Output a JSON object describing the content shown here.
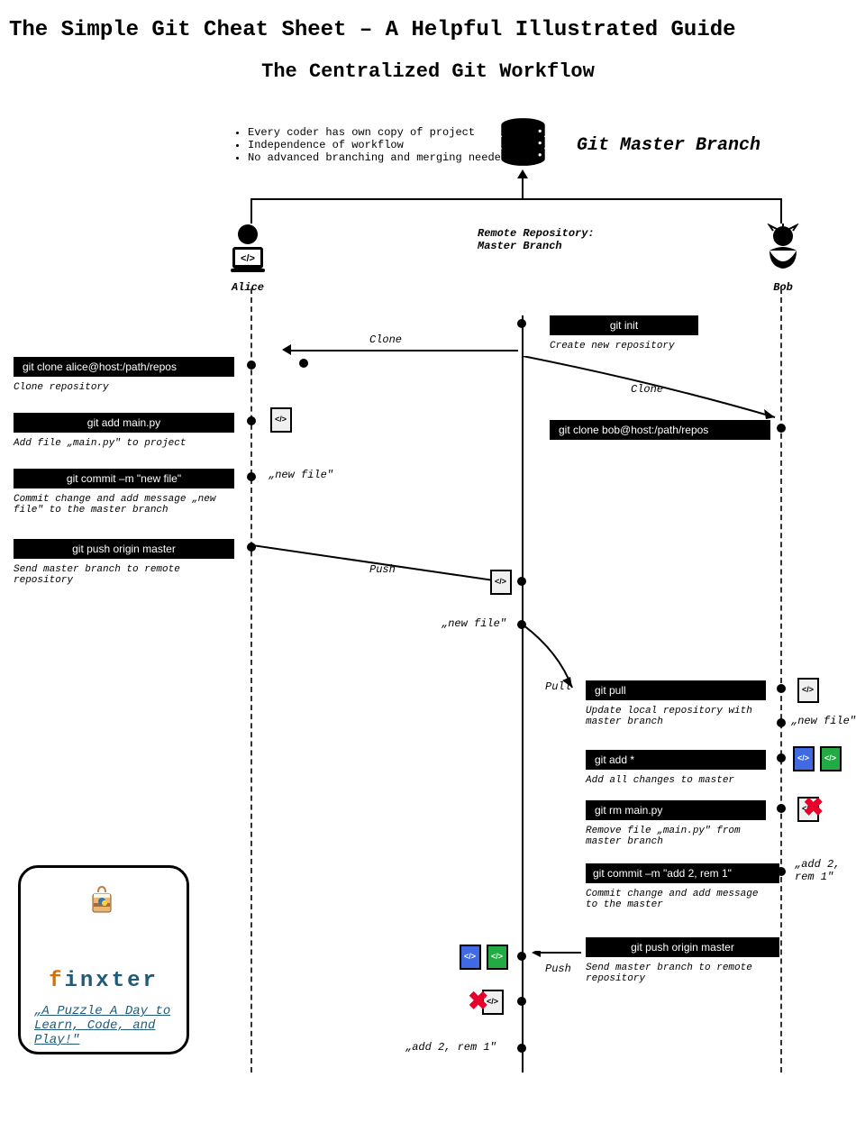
{
  "title": "The Simple Git Cheat Sheet – A Helpful Illustrated Guide",
  "subtitle": "The Centralized Git Workflow",
  "bullets": [
    "Every coder  has own copy of project",
    "Independence of workflow",
    "No advanced branching and merging needed"
  ],
  "master_branch": "Git Master Branch",
  "remote_label1": "Remote Repository:",
  "remote_label2": "Master Branch",
  "people": {
    "alice": "Alice",
    "bob": "Bob"
  },
  "labels": {
    "clone": "Clone",
    "push": "Push",
    "pull": "Pull",
    "new_file": "„new file\"",
    "add2rem1": "„add 2, rem 1\"",
    "add2rem1b": "„add 2,\nrem 1\""
  },
  "alice_cmds": [
    {
      "cmd": "git clone alice@host:/path/repos",
      "desc": "Clone repository"
    },
    {
      "cmd": "git add main.py",
      "desc": "Add file „main.py\" to project"
    },
    {
      "cmd": "git commit –m \"new file\"",
      "desc": "Commit change and add message „new file\" to the master branch"
    },
    {
      "cmd": "git push origin master",
      "desc": "Send master branch to remote repository"
    }
  ],
  "center_cmds": [
    {
      "cmd": "git init",
      "desc": "Create new repository"
    }
  ],
  "bob_cmds": [
    {
      "cmd": "git clone bob@host:/path/repos",
      "desc": ""
    },
    {
      "cmd": "git pull",
      "desc": "Update local repository with master branch"
    },
    {
      "cmd": "git add *",
      "desc": "Add all changes to master"
    },
    {
      "cmd": "git rm main.py",
      "desc": "Remove file „main.py\" from master branch"
    },
    {
      "cmd": "git commit –m \"add 2, rem 1\"",
      "desc": "Commit change and add message to the master"
    },
    {
      "cmd": "git push origin master",
      "desc": "Send master branch to remote repository"
    }
  ],
  "finxter": {
    "brand_f": "f",
    "brand_rest": "inxter",
    "tagline": "„A Puzzle A Day to Learn, Code, and Play!\""
  }
}
